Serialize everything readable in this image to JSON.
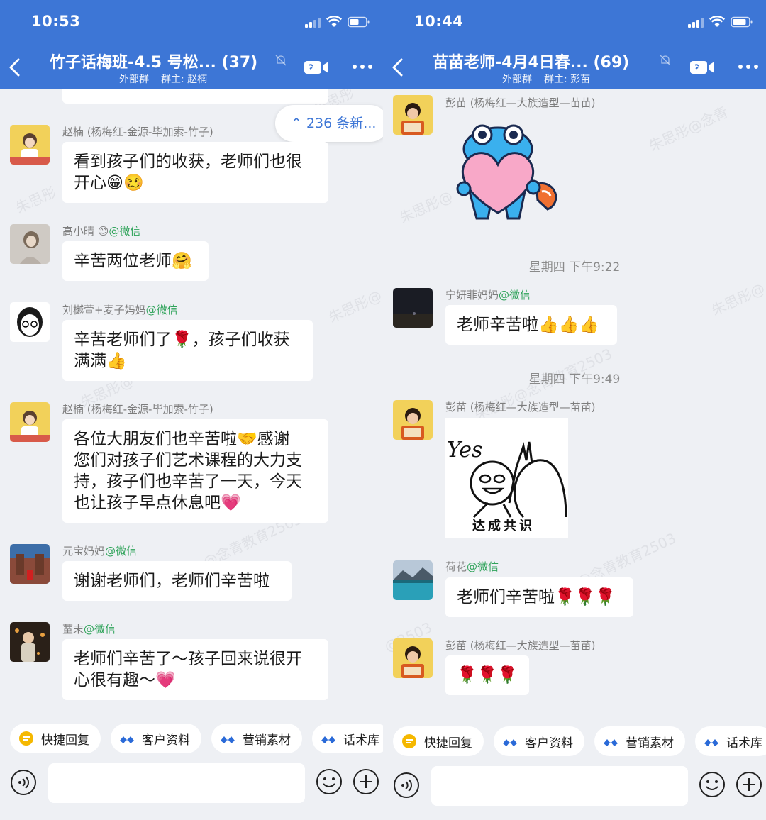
{
  "left": {
    "status_time": "10:53",
    "title": "竹子话梅班-4.5 号松...",
    "member_count": "(37)",
    "subtitle_type": "外部群",
    "subtitle_owner": "群主: 赵楠",
    "new_messages": "236 条新...",
    "messages": [
      {
        "sender": "赵楠 (杨梅红-金源-毕加索-竹子)",
        "text_lines": [
          "看到孩子们的收获，老师们也很",
          "开心😁🥴"
        ]
      },
      {
        "sender": "高小晴 😊",
        "wechat": "@微信",
        "text_lines": [
          "辛苦两位老师🤗"
        ]
      },
      {
        "sender": "刘樾萱+麦子妈妈",
        "wechat": "@微信",
        "text_lines": [
          "辛苦老师们了🌹，孩子们收获",
          "满满👍"
        ]
      },
      {
        "sender": "赵楠 (杨梅红-金源-毕加索-竹子)",
        "text_lines": [
          "各位大朋友们也辛苦啦🤝感谢",
          "您们对孩子们艺术课程的大力支",
          "持，孩子们也辛苦了一天，今天",
          "也让孩子早点休息吧💗"
        ]
      },
      {
        "sender": "元宝妈妈",
        "wechat": "@微信",
        "text_lines": [
          "谢谢老师们，老师们辛苦啦"
        ]
      },
      {
        "sender": "蕫末",
        "wechat": "@微信",
        "text_lines": [
          "老师们辛苦了～孩子回来说很开",
          "心很有趣～💗"
        ]
      }
    ],
    "toolbar": [
      "快捷回复",
      "客户资料",
      "营销素材",
      "话术库"
    ]
  },
  "right": {
    "status_time": "10:44",
    "title": "苗苗老师-4月4日春...",
    "member_count": "(69)",
    "subtitle_type": "外部群",
    "subtitle_owner": "群主: 彭苗",
    "messages": [
      {
        "sender": "彭苗 (杨梅红—大族造型—苗苗)"
      },
      {
        "timestamp": "星期四 下午9:22"
      },
      {
        "sender": "宁妍菲妈妈",
        "wechat": "@微信",
        "text_lines": [
          "老师辛苦啦👍👍👍"
        ]
      },
      {
        "timestamp": "星期四 下午9:49"
      },
      {
        "sender": "彭苗 (杨梅红—大族造型—苗苗)",
        "sticker_text_top": "Yes",
        "sticker_text_bottom": "达成共识"
      },
      {
        "sender": "荷花",
        "wechat": "@微信",
        "text_lines": [
          "老师们辛苦啦🌹🌹🌹"
        ]
      },
      {
        "sender": "彭苗 (杨梅红—大族造型—苗苗)",
        "text_lines": [
          "🌹🌹🌹"
        ]
      }
    ],
    "toolbar": [
      "快捷回复",
      "客户资料",
      "营销素材",
      "话术库"
    ]
  },
  "colors": {
    "header": "#3d76d6",
    "chat_bg": "#eef0f4",
    "wechat_green": "#2fa35a",
    "accent": "#3d76d6"
  },
  "icons": [
    "back-icon",
    "mute-icon",
    "video-call-icon",
    "more-icon",
    "voice-icon",
    "emoji-icon",
    "plus-icon",
    "quick-reply-icon",
    "brand-icon"
  ]
}
